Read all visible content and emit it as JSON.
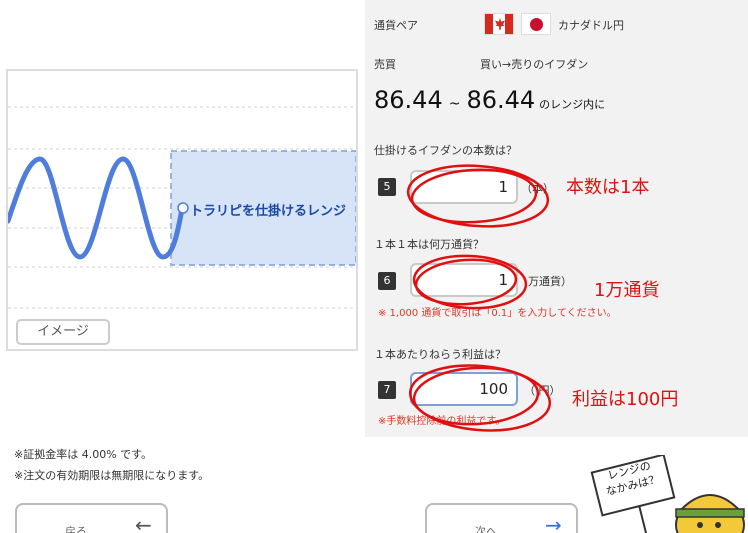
{
  "panel": {
    "pair_label": "通貨ペア",
    "pair_value": "カナダドル円",
    "side_label": "売買",
    "side_value": "買い→売りのイフダン",
    "range_low": "86.44",
    "range_sep": "~",
    "range_high": "86.44",
    "range_tail": "のレンジ内に",
    "q_count": "仕掛けるイフダンの本数は？",
    "step5": "5",
    "count_value": "1",
    "count_unit": "（本）",
    "q_unit": "１本１本は何万通貨？",
    "step6": "6",
    "unit_value": "1",
    "unit_unit": "万通貨）",
    "unit_note": "※ 1,000 通貨で取引は「0.1」を入力してください。",
    "q_profit": "１本あたりねらう利益は？",
    "step7": "7",
    "profit_value": "100",
    "profit_unit": "（ 円）",
    "profit_note": "※手数料控除前の利益です。"
  },
  "annotations": {
    "count": "本数は1本",
    "unit": "1万通貨",
    "profit": "利益は100円"
  },
  "illustration": {
    "range_label": "トラリピを仕掛けるレンジ",
    "tag": "イメージ"
  },
  "footer": {
    "margin_rate": "※証拠金率は 4.00% です。",
    "expiry": "※注文の有効期限は無期限になります。",
    "back_label": "戻る",
    "back_arrow": "←",
    "next_label": "次へ",
    "next_arrow": "→"
  },
  "mascot": {
    "sign_line1": "レンジの",
    "sign_line2": "なかみは？"
  },
  "colors": {
    "annotation_red": "#e01010",
    "range_blue": "#1a4aa8",
    "wave_blue": "#4f7ddb",
    "panel_bg": "#f2f2f2"
  }
}
